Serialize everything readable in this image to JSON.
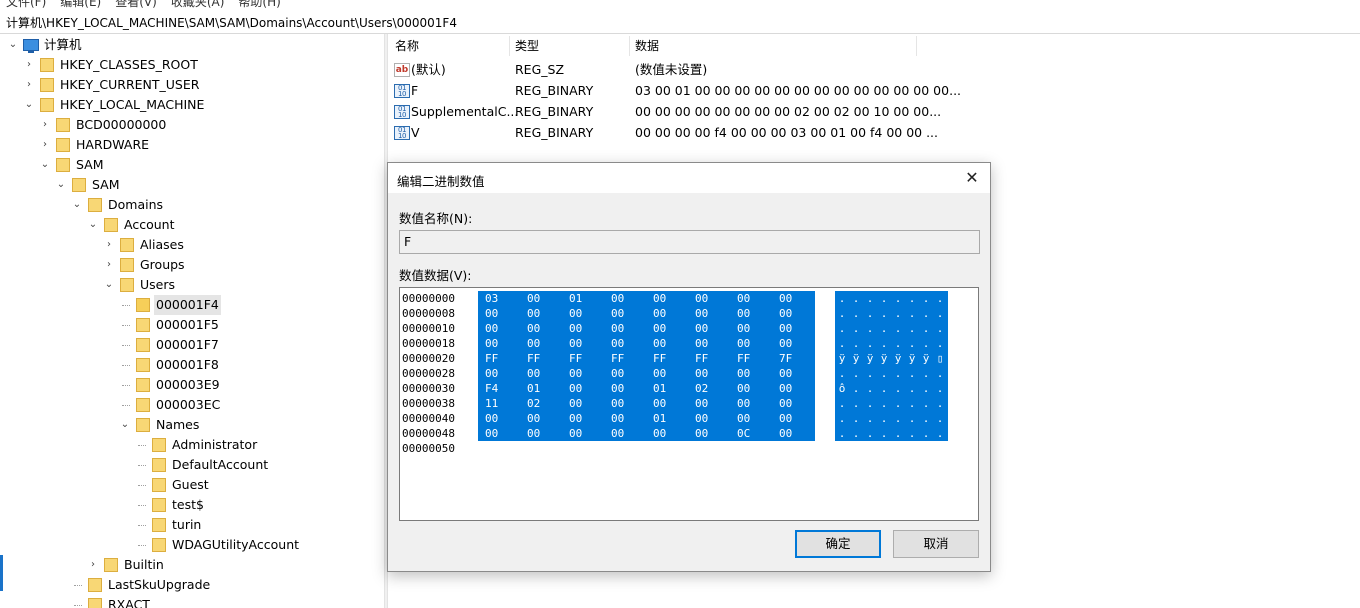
{
  "menu": [
    "文件(F)",
    "编辑(E)",
    "查看(V)",
    "收藏夹(A)",
    "帮助(H)"
  ],
  "address_path": "计算机\\HKEY_LOCAL_MACHINE\\SAM\\SAM\\Domains\\Account\\Users\\000001F4",
  "tree": {
    "root": "计算机",
    "items": [
      {
        "label": "HKEY_CLASSES_ROOT",
        "level": 1,
        "expander": "collapsed"
      },
      {
        "label": "HKEY_CURRENT_USER",
        "level": 1,
        "expander": "collapsed"
      },
      {
        "label": "HKEY_LOCAL_MACHINE",
        "level": 1,
        "expander": "expanded"
      },
      {
        "label": "BCD00000000",
        "level": 2,
        "expander": "collapsed"
      },
      {
        "label": "HARDWARE",
        "level": 2,
        "expander": "collapsed"
      },
      {
        "label": "SAM",
        "level": 2,
        "expander": "expanded"
      },
      {
        "label": "SAM",
        "level": 3,
        "expander": "expanded"
      },
      {
        "label": "Domains",
        "level": 4,
        "expander": "expanded"
      },
      {
        "label": "Account",
        "level": 5,
        "expander": "expanded"
      },
      {
        "label": "Aliases",
        "level": 6,
        "expander": "collapsed"
      },
      {
        "label": "Groups",
        "level": 6,
        "expander": "collapsed"
      },
      {
        "label": "Users",
        "level": 6,
        "expander": "expanded"
      },
      {
        "label": "000001F4",
        "level": 7,
        "expander": "none",
        "selected": true
      },
      {
        "label": "000001F5",
        "level": 7,
        "expander": "none"
      },
      {
        "label": "000001F7",
        "level": 7,
        "expander": "none"
      },
      {
        "label": "000001F8",
        "level": 7,
        "expander": "none"
      },
      {
        "label": "000003E9",
        "level": 7,
        "expander": "none"
      },
      {
        "label": "000003EC",
        "level": 7,
        "expander": "none"
      },
      {
        "label": "Names",
        "level": 7,
        "expander": "expanded"
      },
      {
        "label": "Administrator",
        "level": 8,
        "expander": "none"
      },
      {
        "label": "DefaultAccount",
        "level": 8,
        "expander": "none"
      },
      {
        "label": "Guest",
        "level": 8,
        "expander": "none"
      },
      {
        "label": "test$",
        "level": 8,
        "expander": "none"
      },
      {
        "label": "turin",
        "level": 8,
        "expander": "none"
      },
      {
        "label": "WDAGUtilityAccount",
        "level": 8,
        "expander": "none"
      },
      {
        "label": "Builtin",
        "level": 5,
        "expander": "collapsed"
      },
      {
        "label": "LastSkuUpgrade",
        "level": 4,
        "expander": "none"
      },
      {
        "label": "RXACT",
        "level": 4,
        "expander": "none"
      }
    ]
  },
  "values_list": {
    "columns": [
      "名称",
      "类型",
      "数据"
    ],
    "rows": [
      {
        "icon": "string-value-icon",
        "name": "(默认)",
        "type": "REG_SZ",
        "data": "(数值未设置)"
      },
      {
        "icon": "binary-value-icon",
        "name": "F",
        "type": "REG_BINARY",
        "data": "03 00 01 00 00 00 00 00 00 00 00 00 00 00 00 00..."
      },
      {
        "icon": "binary-value-icon",
        "name": "SupplementalC...",
        "type": "REG_BINARY",
        "data": "00 00 00 00 00 00 00 00 02 00 02 00 10 00 00..."
      },
      {
        "icon": "binary-value-icon",
        "name": "V",
        "type": "REG_BINARY",
        "data": "00 00 00 00 f4 00 00 00 03 00 01 00 f4 00 00 ..."
      }
    ]
  },
  "dialog": {
    "title": "编辑二进制数值",
    "close_glyph": "✕",
    "name_label": "数值名称(N):",
    "name_value": "F",
    "data_label": "数值数据(V):",
    "hex_rows": [
      {
        "offset": "00000000",
        "bytes": [
          "03",
          "00",
          "01",
          "00",
          "00",
          "00",
          "00",
          "00"
        ],
        "ascii": [
          ".",
          ".",
          ".",
          ".",
          ".",
          ".",
          ".",
          "."
        ]
      },
      {
        "offset": "00000008",
        "bytes": [
          "00",
          "00",
          "00",
          "00",
          "00",
          "00",
          "00",
          "00"
        ],
        "ascii": [
          ".",
          ".",
          ".",
          ".",
          ".",
          ".",
          ".",
          "."
        ]
      },
      {
        "offset": "00000010",
        "bytes": [
          "00",
          "00",
          "00",
          "00",
          "00",
          "00",
          "00",
          "00"
        ],
        "ascii": [
          ".",
          ".",
          ".",
          ".",
          ".",
          ".",
          ".",
          "."
        ]
      },
      {
        "offset": "00000018",
        "bytes": [
          "00",
          "00",
          "00",
          "00",
          "00",
          "00",
          "00",
          "00"
        ],
        "ascii": [
          ".",
          ".",
          ".",
          ".",
          ".",
          ".",
          ".",
          "."
        ]
      },
      {
        "offset": "00000020",
        "bytes": [
          "FF",
          "FF",
          "FF",
          "FF",
          "FF",
          "FF",
          "FF",
          "7F"
        ],
        "ascii": [
          "ÿ",
          "ÿ",
          "ÿ",
          "ÿ",
          "ÿ",
          "ÿ",
          "ÿ",
          "▯"
        ]
      },
      {
        "offset": "00000028",
        "bytes": [
          "00",
          "00",
          "00",
          "00",
          "00",
          "00",
          "00",
          "00"
        ],
        "ascii": [
          ".",
          ".",
          ".",
          ".",
          ".",
          ".",
          ".",
          "."
        ]
      },
      {
        "offset": "00000030",
        "bytes": [
          "F4",
          "01",
          "00",
          "00",
          "01",
          "02",
          "00",
          "00"
        ],
        "ascii": [
          "ô",
          ".",
          ".",
          ".",
          ".",
          ".",
          ".",
          "."
        ]
      },
      {
        "offset": "00000038",
        "bytes": [
          "11",
          "02",
          "00",
          "00",
          "00",
          "00",
          "00",
          "00"
        ],
        "ascii": [
          ".",
          ".",
          ".",
          ".",
          ".",
          ".",
          ".",
          "."
        ]
      },
      {
        "offset": "00000040",
        "bytes": [
          "00",
          "00",
          "00",
          "00",
          "01",
          "00",
          "00",
          "00"
        ],
        "ascii": [
          ".",
          ".",
          ".",
          ".",
          ".",
          ".",
          ".",
          "."
        ]
      },
      {
        "offset": "00000048",
        "bytes": [
          "00",
          "00",
          "00",
          "00",
          "00",
          "00",
          "0C",
          "00"
        ],
        "ascii": [
          ".",
          ".",
          ".",
          ".",
          ".",
          ".",
          ".",
          "."
        ]
      },
      {
        "offset": "00000050",
        "bytes": [],
        "ascii": []
      }
    ],
    "ok_label": "确定",
    "cancel_label": "取消"
  }
}
